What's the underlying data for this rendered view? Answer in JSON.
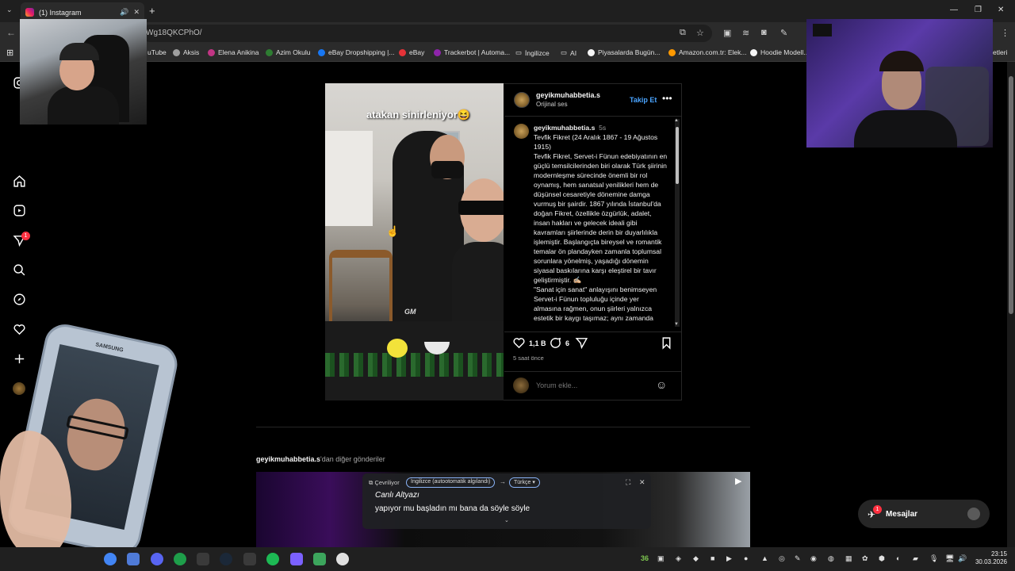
{
  "browser": {
    "tab_title": "(1) Instagram",
    "url": "Wg18QKCPhO/",
    "bookmarks": [
      {
        "label": "uTube",
        "color": "#ff0000"
      },
      {
        "label": "Aksis",
        "color": "#9e9e9e"
      },
      {
        "label": "Elena Anikina",
        "color": "#c13584"
      },
      {
        "label": "Azim Okulu",
        "color": "#2e7d32"
      },
      {
        "label": "eBay Dropshipping |...",
        "color": "#1877f2"
      },
      {
        "label": "eBay",
        "color": "#e53238"
      },
      {
        "label": "Trackerbot | Automa...",
        "color": "#8e24aa"
      },
      {
        "label": "İngilizce",
        "color": "#9e9e9e"
      },
      {
        "label": "AI",
        "color": "#9e9e9e"
      },
      {
        "label": "Piyasalarda Bugün...",
        "color": "#f5f5f5"
      },
      {
        "label": "Amazon.com.tr: Elek...",
        "color": "#ff9900"
      },
      {
        "label": "Hoodie Modell...",
        "color": "#f5f5f5"
      },
      {
        "label": "etleri",
        "color": "#9e9e9e"
      }
    ]
  },
  "sidebar": {
    "notification_count": "1",
    "icons": [
      "instagram-icon",
      "home-icon",
      "reels-icon",
      "messages-icon",
      "search-icon",
      "explore-icon",
      "heart-icon",
      "create-icon",
      "profile-icon"
    ]
  },
  "post": {
    "video_overlay_text": "atakan sinirleniyor😆",
    "video_logo": "GM",
    "username": "geyikmuhabbetia.s",
    "audio": "Orijinal ses",
    "follow_label": "Takip Et",
    "more_label": "•••",
    "caption_time": "5s",
    "caption": "Tevfik Fikret (24 Aralık 1867 - 19 Ağustos 1915)\nTevfik Fikret, Servet-i Fünun edebiyatının en güçlü temsilcilerinden biri olarak Türk şiirinin modernleşme sürecinde önemli bir rol oynamış, hem sanatsal yenilikleri hem de düşünsel cesaretiyle dönemine damga vurmuş bir şairdir. 1867 yılında İstanbul'da doğan Fikret, özellikle özgürlük, adalet, insan hakları ve gelecek ideali gibi kavramları şiirlerinde derin bir duyarlılıkla işlemiştir. Başlangıçta bireysel ve romantik temalar ön plandayken zamanla toplumsal sorunlara yönelmiş, yaşadığı dönemin siyasal baskılarına karşı eleştirel bir tavır geliştirmiştir. ✍🏼\n\"Sanat için sanat\" anlayışını benimseyen Servet-i Fünun topluluğu içinde yer almasına rağmen, onun şiirleri yalnızca estetik bir kaygı taşımaz; aynı zamanda",
    "likes": "1,1 B",
    "comments": "6",
    "time_ago": "5 saat önce",
    "comment_placeholder": "Yorum ekle..."
  },
  "more_from": {
    "username": "geyikmuhabbetia.s",
    "suffix": "'dan diğer gönderiler"
  },
  "live_caption": {
    "status": "Çevriliyor",
    "source_lang": "İngilizce (autootomatik algılandı)",
    "target_lang": "Türkçe",
    "title": "Canlı Altyazı",
    "text": "yapıyor mu başladın mı bana da söyle söyle"
  },
  "messages_button": {
    "label": "Mesajlar",
    "badge": "1"
  },
  "phone": {
    "brand": "SAMSUNG"
  },
  "taskbar": {
    "time": "23:15",
    "date": "30.03.2026",
    "app_colors": [
      "#4285f4",
      "#4f7bd8",
      "#5865f2",
      "#1e9e4a",
      "#3a3a3a",
      "#1b2838",
      "#3a3a3a",
      "#1db954",
      "#7b61ff",
      "#3ca55c",
      "#e0e0e0"
    ],
    "tray_labels": [
      "36"
    ]
  }
}
